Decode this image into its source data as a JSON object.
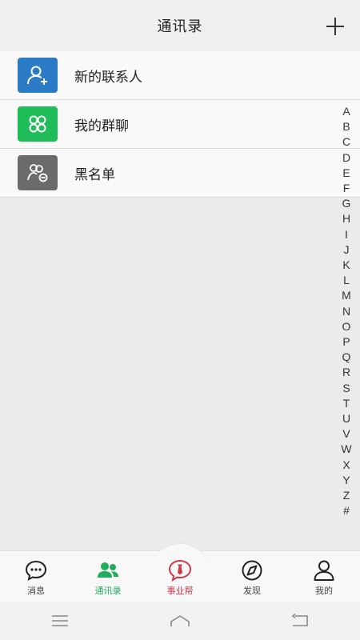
{
  "header": {
    "title": "通讯录",
    "add_icon": "plus-icon"
  },
  "rows": [
    {
      "label": "新的联系人",
      "icon": "add-person-icon",
      "color": "#2979c8"
    },
    {
      "label": "我的群聊",
      "icon": "group-icon",
      "color": "#1fbd5a"
    },
    {
      "label": "黑名单",
      "icon": "blocked-people-icon",
      "color": "#6b6b6b"
    }
  ],
  "alphabet": [
    "A",
    "B",
    "C",
    "D",
    "E",
    "F",
    "G",
    "H",
    "I",
    "J",
    "K",
    "L",
    "M",
    "N",
    "O",
    "P",
    "Q",
    "R",
    "S",
    "T",
    "U",
    "V",
    "W",
    "X",
    "Y",
    "Z",
    "#"
  ],
  "tabs": [
    {
      "label": "消息",
      "icon": "chat-bubble-icon",
      "active": false
    },
    {
      "label": "通讯录",
      "icon": "contacts-icon",
      "active": true
    },
    {
      "label": "事业帮",
      "icon": "tie-bubble-icon",
      "active": false
    },
    {
      "label": "发现",
      "icon": "compass-icon",
      "active": false
    },
    {
      "label": "我的",
      "icon": "person-icon",
      "active": false
    }
  ],
  "colors": {
    "accent": "#1fad5b",
    "center_tab": "#d0394b"
  },
  "system_nav": [
    "menu-icon",
    "home-icon",
    "back-icon"
  ]
}
